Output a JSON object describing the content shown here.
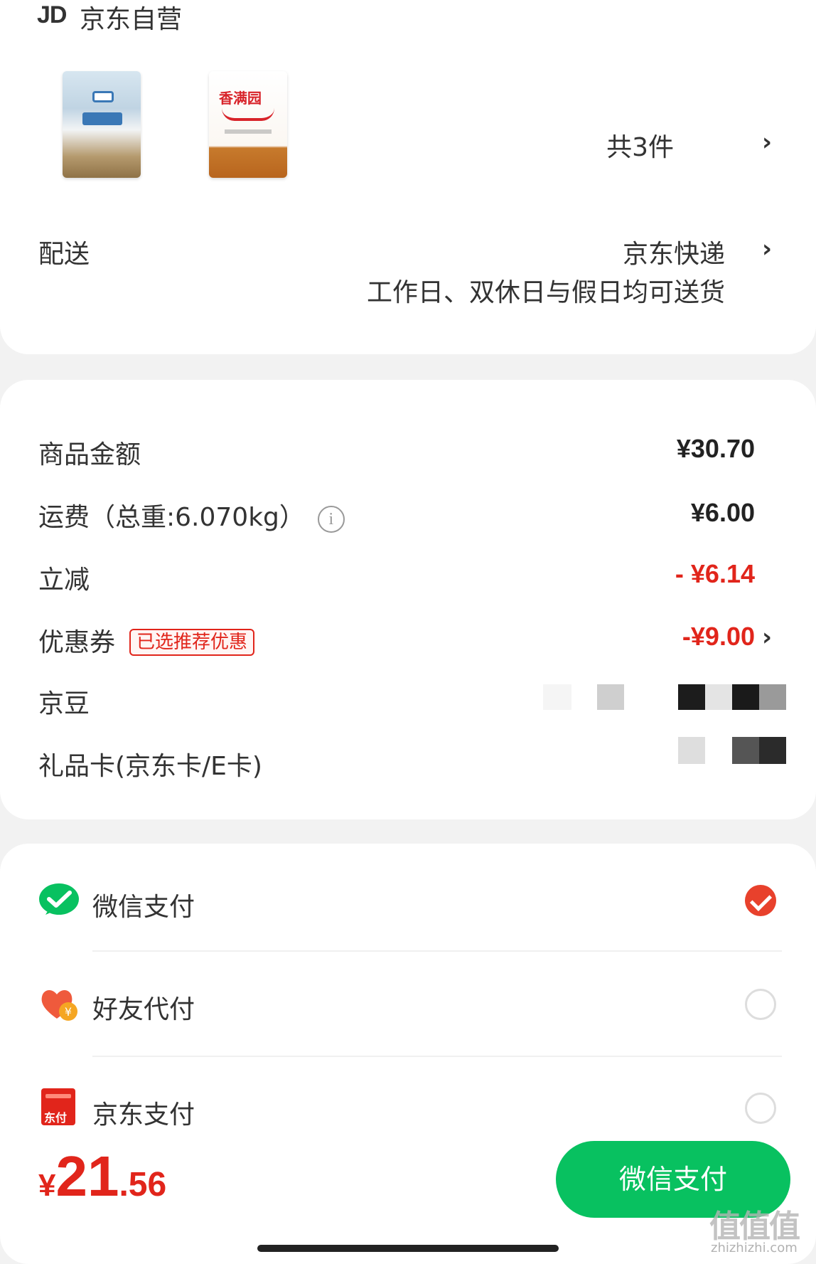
{
  "store": {
    "logo": "JD",
    "name": "京东自营"
  },
  "products": {
    "count_label": "共3件"
  },
  "delivery": {
    "label": "配送",
    "method": "京东快递",
    "note": "工作日、双休日与假日均可送货"
  },
  "price": {
    "goods_label": "商品金额",
    "goods_value": "¥30.70",
    "shipping_label": "运费（总重:6.070kg）",
    "shipping_info_icon": "i",
    "shipping_value": "¥6.00",
    "discount_label": "立减",
    "discount_value": "- ¥6.14",
    "coupon_label": "优惠券",
    "coupon_tag": "已选推荐优惠",
    "coupon_value": "-¥9.00",
    "beans_label": "京豆",
    "giftcard_label": "礼品卡(京东卡/E卡)"
  },
  "payment": {
    "options": [
      {
        "label": "微信支付",
        "icon": "wechat-pay-icon",
        "selected": true
      },
      {
        "label": "好友代付",
        "icon": "friend-pay-icon",
        "selected": false
      },
      {
        "label": "京东支付",
        "icon": "jd-pay-icon",
        "selected": false
      }
    ],
    "jd_pay_icon_text": "东付"
  },
  "footer": {
    "total_currency": "¥",
    "total_int": "21",
    "total_dec": ".56",
    "pay_button": "微信支付"
  },
  "watermark": {
    "main": "值值值",
    "sub": "zhizhizhi.com"
  },
  "colors": {
    "accent_red": "#e1251b",
    "wechat_green": "#08c160",
    "radio_selected": "#e8412c"
  }
}
